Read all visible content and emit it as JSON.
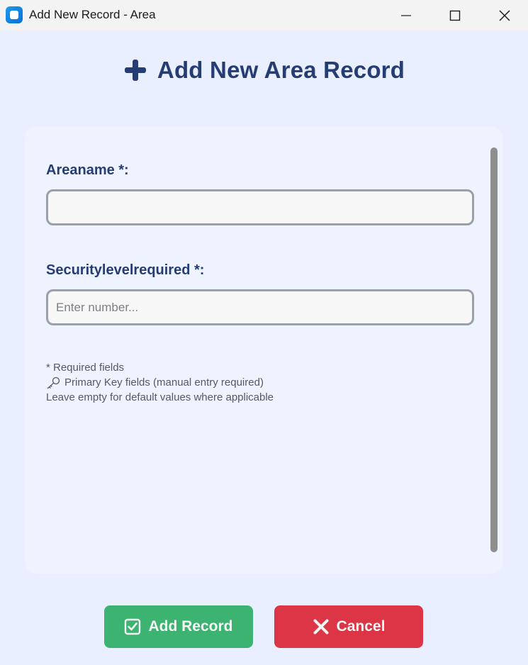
{
  "window": {
    "title": "Add New Record - Area"
  },
  "header": {
    "title": "Add New Area Record"
  },
  "form": {
    "fields": [
      {
        "label": "Areaname *:",
        "value": "",
        "placeholder": ""
      },
      {
        "label": "Securitylevelrequired *:",
        "value": "",
        "placeholder": "Enter number..."
      }
    ],
    "notes": {
      "required": "* Required fields",
      "primary_key": "Primary Key fields (manual entry required)",
      "defaults": "Leave empty for default values where applicable"
    }
  },
  "buttons": {
    "add_label": "Add Record",
    "cancel_label": "Cancel"
  },
  "colors": {
    "accent": "#253d73",
    "add_button": "#3cb371",
    "cancel_button": "#dc3545",
    "background": "#e9efff"
  },
  "icons": [
    "app-icon",
    "minimize-icon",
    "maximize-icon",
    "close-icon",
    "plus-icon",
    "key-icon",
    "checkbox-icon",
    "x-icon"
  ]
}
